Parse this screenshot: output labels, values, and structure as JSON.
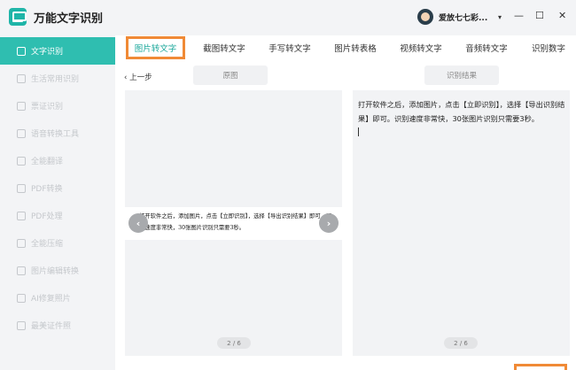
{
  "app": {
    "title": "万能文字识别"
  },
  "sidebar": {
    "items": [
      {
        "label": "文字识别",
        "active": true,
        "icon": "text-scan-icon"
      },
      {
        "label": "生活常用识别",
        "active": false,
        "icon": "life-scan-icon"
      },
      {
        "label": "票证识别",
        "active": false,
        "icon": "ticket-scan-icon"
      },
      {
        "label": "语音转换工具",
        "active": false,
        "icon": "voice-icon"
      },
      {
        "label": "全能翻译",
        "active": false,
        "icon": "translate-icon"
      },
      {
        "label": "PDF转换",
        "active": false,
        "icon": "pdf-convert-icon"
      },
      {
        "label": "PDF处理",
        "active": false,
        "icon": "pdf-process-icon"
      },
      {
        "label": "全能压缩",
        "active": false,
        "icon": "compress-icon"
      },
      {
        "label": "图片编辑转换",
        "active": false,
        "icon": "image-edit-icon"
      },
      {
        "label": "AI修复照片",
        "active": false,
        "icon": "ai-repair-icon"
      },
      {
        "label": "最美证件照",
        "active": false,
        "icon": "id-photo-icon"
      }
    ]
  },
  "header": {
    "username": "爱放七七彩...",
    "caret": "▾",
    "minimize": "—",
    "maximize": "☐",
    "close": "✕"
  },
  "tabs": [
    {
      "label": "图片转文字",
      "active": true
    },
    {
      "label": "截图转文字",
      "active": false
    },
    {
      "label": "手写转文字",
      "active": false
    },
    {
      "label": "图片转表格",
      "active": false
    },
    {
      "label": "视频转文字",
      "active": false
    },
    {
      "label": "音频转文字",
      "active": false
    },
    {
      "label": "识别数字",
      "active": false
    }
  ],
  "main": {
    "back_label": "上一步",
    "original_label": "原图",
    "result_label": "识别结果",
    "original_text": "打开软件之后，添加图片，点击【立即识别】，选择【导出识别结果】即可，识别速度非常快，30张图片识别只需要3秒。",
    "result_text": "打开软件之后，添加图片，点击【立即识别】，选择【导出识别结果】即可。识别速度非常快，30张图片识别只需要3秒。",
    "original_page": "2 / 6",
    "result_page": "2 / 6",
    "prev_arrow": "‹",
    "next_arrow": "›"
  },
  "colors": {
    "accent": "#2fbeb0",
    "highlight": "#f08a36"
  }
}
